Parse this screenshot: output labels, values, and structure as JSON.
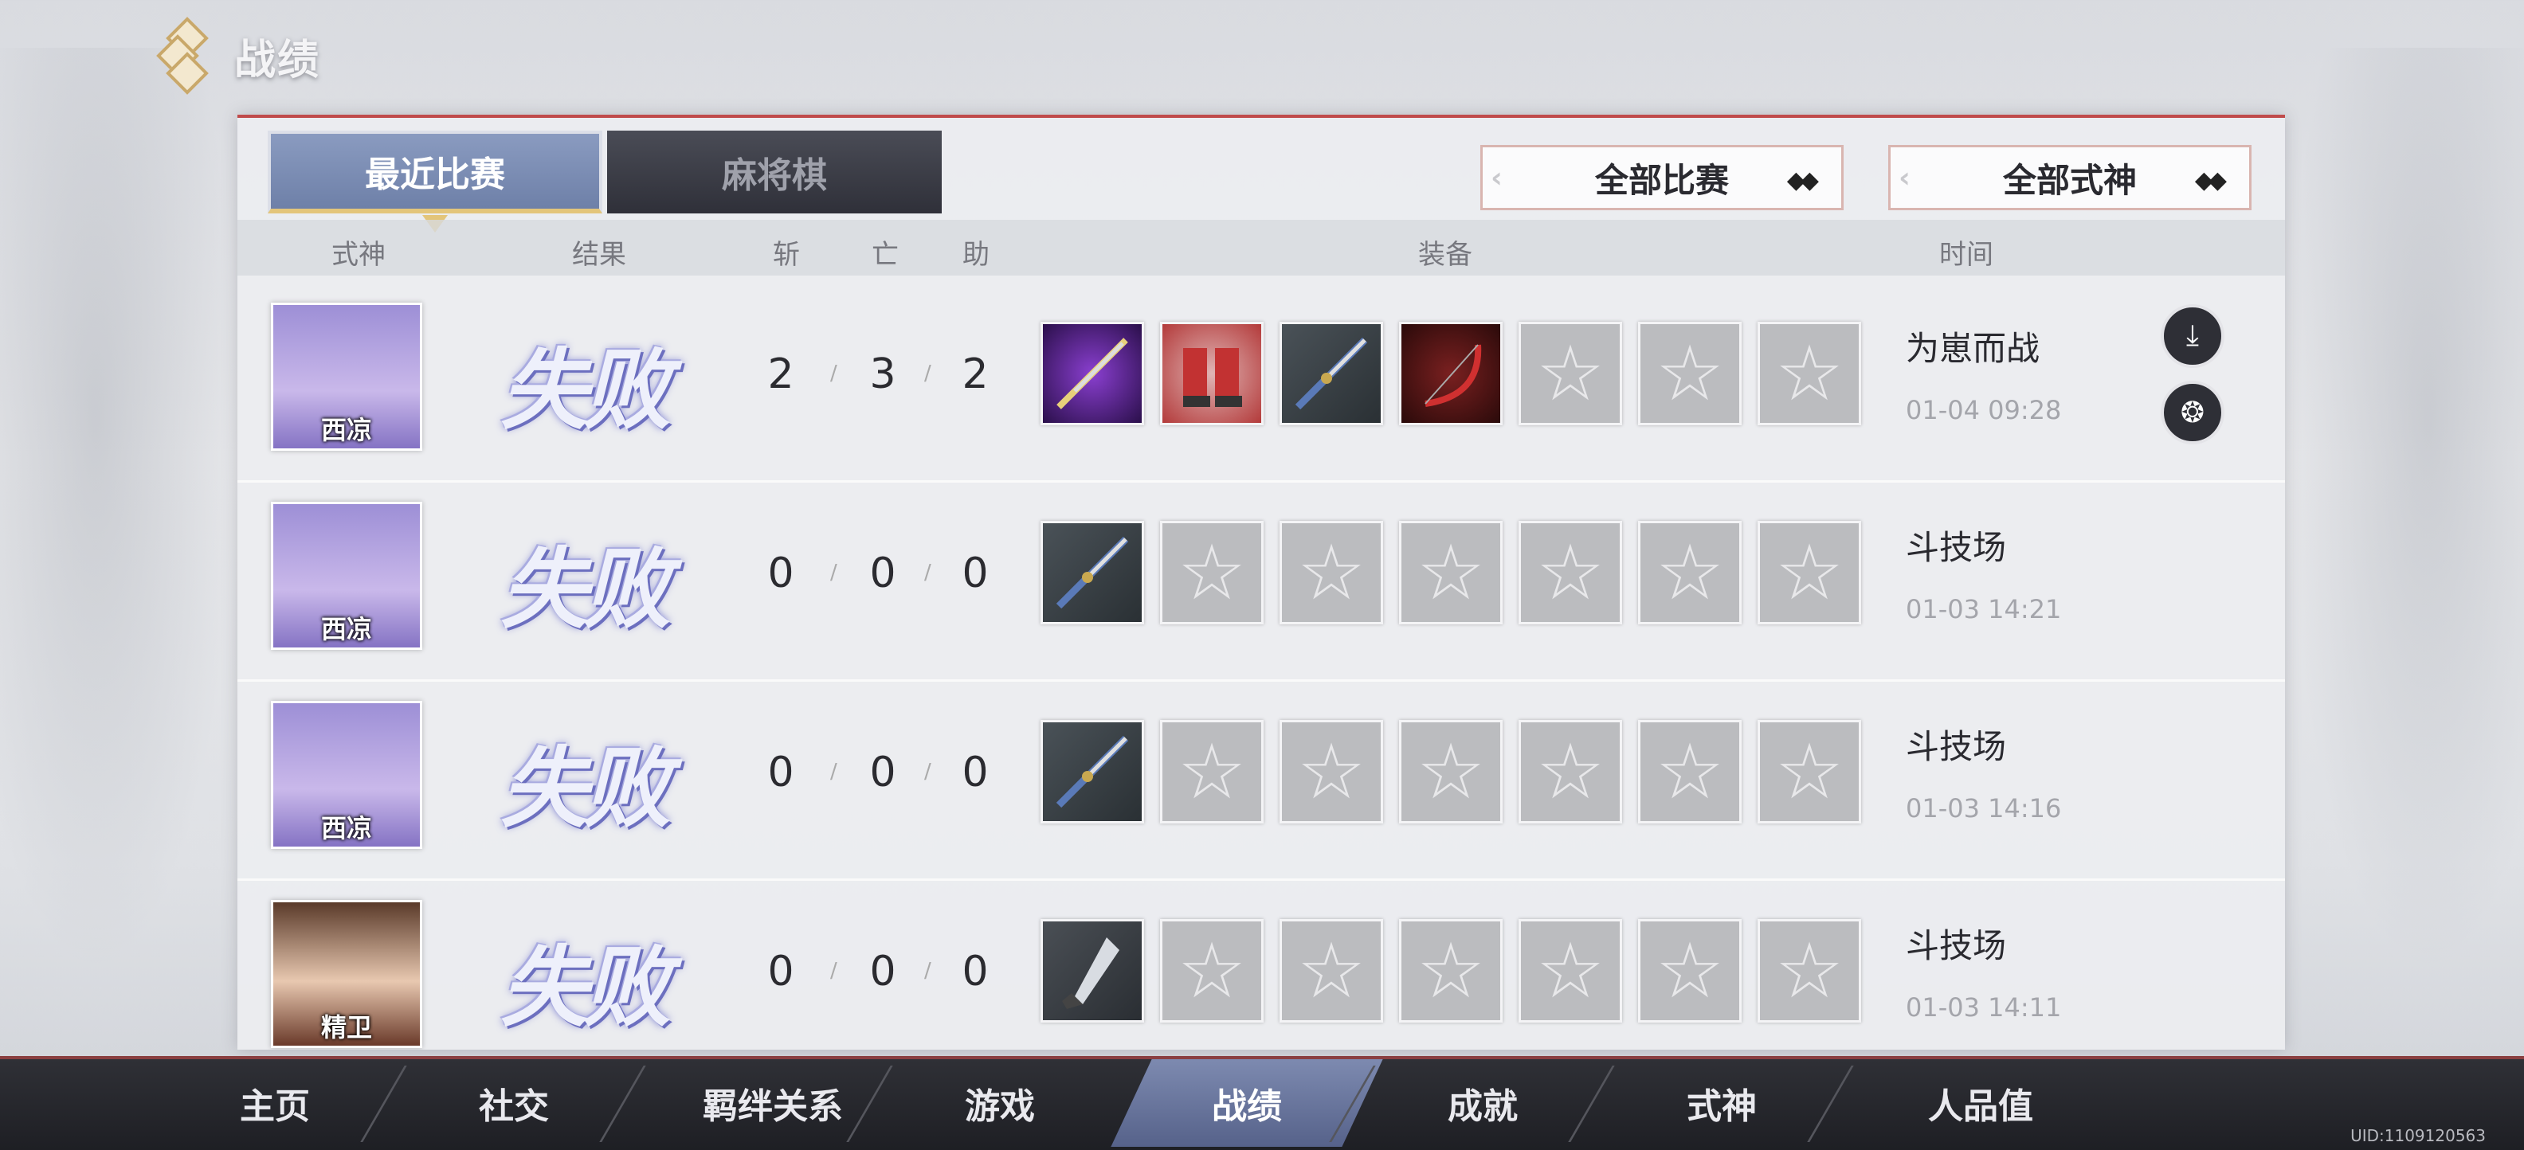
{
  "header": {
    "title": "战绩"
  },
  "tabs": [
    {
      "label": "最近比赛",
      "active": true
    },
    {
      "label": "麻将棋",
      "active": false
    }
  ],
  "filters": {
    "matches": "全部比赛",
    "shikigami": "全部式神"
  },
  "columns": {
    "shikigami": "式神",
    "result": "结果",
    "kills": "斩",
    "deaths": "亡",
    "assists": "助",
    "equipment": "装备",
    "time": "时间"
  },
  "rows": [
    {
      "name": "西凉",
      "result": "失败",
      "kills": "2",
      "deaths": "3",
      "assists": "2",
      "mode": "为崽而战",
      "time": "01-04 09:28",
      "equipment": [
        "katana-purple-icon",
        "red-armor-boots-icon",
        "blue-katana-icon",
        "red-bow-icon",
        "empty",
        "empty",
        "empty"
      ]
    },
    {
      "name": "西凉",
      "result": "失败",
      "kills": "0",
      "deaths": "0",
      "assists": "0",
      "mode": "斗技场",
      "time": "01-03 14:21",
      "equipment": [
        "blue-katana-icon",
        "empty",
        "empty",
        "empty",
        "empty",
        "empty",
        "empty"
      ]
    },
    {
      "name": "西凉",
      "result": "失败",
      "kills": "0",
      "deaths": "0",
      "assists": "0",
      "mode": "斗技场",
      "time": "01-03 14:16",
      "equipment": [
        "blue-katana-icon",
        "empty",
        "empty",
        "empty",
        "empty",
        "empty",
        "empty"
      ]
    },
    {
      "name": "精卫",
      "result": "失败",
      "kills": "0",
      "deaths": "0",
      "assists": "0",
      "mode": "斗技场",
      "time": "01-03 14:11",
      "equipment": [
        "kunai-icon",
        "empty",
        "empty",
        "empty",
        "empty",
        "empty",
        "empty"
      ]
    }
  ],
  "nav": [
    {
      "label": "主页"
    },
    {
      "label": "社交"
    },
    {
      "label": "羁绊关系"
    },
    {
      "label": "游戏"
    },
    {
      "label": "战绩",
      "active": true
    },
    {
      "label": "成就"
    },
    {
      "label": "式神"
    },
    {
      "label": "人品值"
    }
  ],
  "uid": "UID:1109120563",
  "colors": {
    "accent": "#c04b4b",
    "active_tab": "#7d8ab0",
    "gold": "#e3c57a"
  }
}
